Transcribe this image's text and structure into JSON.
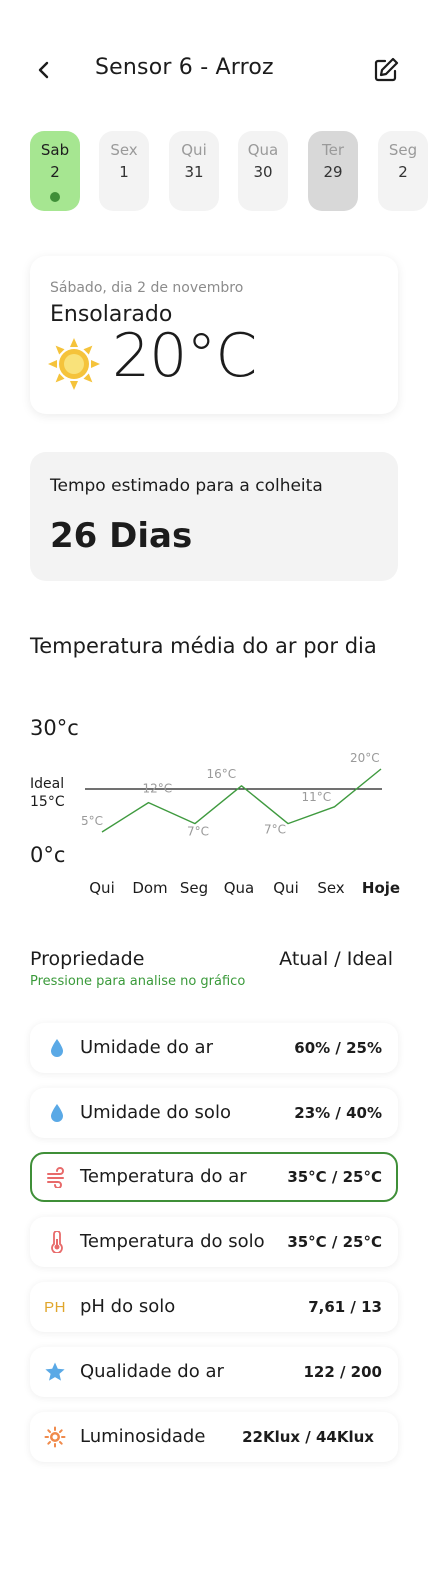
{
  "header": {
    "title": "Sensor 6 - Arroz"
  },
  "days": [
    {
      "name": "Sab",
      "num": "2",
      "state": "active"
    },
    {
      "name": "Sex",
      "num": "1",
      "state": "normal"
    },
    {
      "name": "Qui",
      "num": "31",
      "state": "normal"
    },
    {
      "name": "Qua",
      "num": "30",
      "state": "normal"
    },
    {
      "name": "Ter",
      "num": "29",
      "state": "past"
    },
    {
      "name": "Seg",
      "num": "2",
      "state": "normal"
    }
  ],
  "weather": {
    "date": "Sábado, dia 2 de novembro",
    "condition": "Ensolarado",
    "temperature": "20°C",
    "icon": "sun-icon"
  },
  "harvest": {
    "label": "Tempo estimado para a colheita",
    "value": "26 Dias"
  },
  "chart_title": "Temperatura média do ar por dia",
  "chart_data": {
    "type": "line",
    "categories": [
      "Qui",
      "Dom",
      "Seg",
      "Qua",
      "Qui",
      "Sex",
      "Hoje"
    ],
    "values": [
      5,
      12,
      7,
      16,
      7,
      11,
      20
    ],
    "point_labels": [
      "5°C",
      "12°C",
      "7°C",
      "16°C",
      "7°C",
      "11°C",
      "20°C"
    ],
    "ylim": [
      0,
      30
    ],
    "y_top_label": "30°c",
    "y_bottom_label": "0°c",
    "ideal_label_1": "Ideal",
    "ideal_label_2": "15°C",
    "ideal_value": 15,
    "line_color": "#3f9a3f",
    "ideal_line_color": "#1c1c1c"
  },
  "properties_header": {
    "title": "Propriedade",
    "subtitle": "Pressione para analise no gráfico",
    "right": "Atual / Ideal"
  },
  "properties": [
    {
      "name": "Umidade do ar",
      "value": "60% / 25%",
      "icon": "water-drop-icon",
      "icon_color": "#5aa9e6"
    },
    {
      "name": "Umidade do solo",
      "value": "23% / 40%",
      "icon": "water-drop-icon",
      "icon_color": "#5aa9e6"
    },
    {
      "name": "Temperatura do ar",
      "value": "35°C / 25°C",
      "icon": "wind-icon",
      "icon_color": "#e86a6a",
      "selected": true
    },
    {
      "name": "Temperatura do solo",
      "value": "35°C / 25°C",
      "icon": "thermometer-icon",
      "icon_color": "#e86a6a"
    },
    {
      "name": "pH do solo",
      "value": "7,61 / 13",
      "icon": "ph-icon",
      "icon_text": "PH",
      "icon_color": "#e0a62c"
    },
    {
      "name": "Qualidade do ar",
      "value": "122 / 200",
      "icon": "star-icon",
      "icon_color": "#5aa9e6"
    },
    {
      "name": "Luminosidade",
      "value": "22Klux / 44Klux",
      "icon": "brightness-icon",
      "icon_color": "#f08a4b"
    }
  ]
}
